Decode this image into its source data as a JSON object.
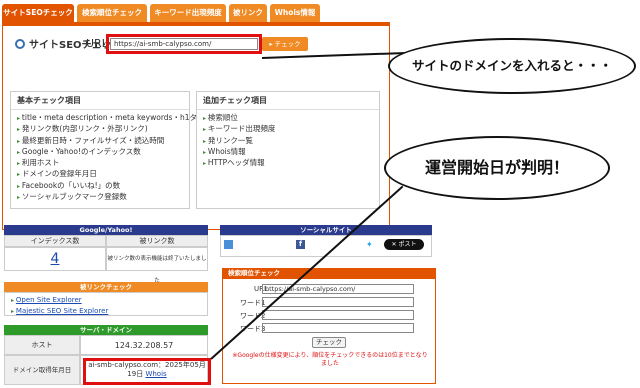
{
  "tabs": [
    {
      "label": "サイトSEOチェック",
      "active": true
    },
    {
      "label": "検索順位チェック",
      "active": false
    },
    {
      "label": "キーワード出現頻度",
      "active": false
    },
    {
      "label": "被リンク",
      "active": false
    },
    {
      "label": "Whois情報",
      "active": false
    }
  ],
  "seo": {
    "title": "サイトSEOチェック",
    "url_label": "URL",
    "url_value": "https://ai-smb-calypso.com/",
    "check_button": "チェック",
    "basic": {
      "title": "基本チェック項目",
      "items": [
        "title・meta description・meta keywords・h1タグ",
        "発リンク数(内部リンク・外部リンク)",
        "最終更新日時・ファイルサイズ・読込時間",
        "Google・Yahoo!のインデックス数",
        "利用ホスト",
        "ドメインの登録年月日",
        "Facebookの「いいね!」の数",
        "ソーシャルブックマーク登録数"
      ]
    },
    "extra": {
      "title": "追加チェック項目",
      "items": [
        "検索順位",
        "キーワード出現頻度",
        "発リンク一覧",
        "Whois情報",
        "HTTPヘッダ情報"
      ]
    }
  },
  "google_yahoo": {
    "header": "Google/Yahoo!",
    "index_label": "インデックス数",
    "backlink_label": "被リンク数",
    "index_value": "4",
    "backlink_note": "被リンク数の表示機能は終了いたしました"
  },
  "social": {
    "header": "ソーシャルサイト",
    "share_button": "ポスト"
  },
  "backlink_check": {
    "header": "被リンクチェック",
    "links": [
      "Open Site Explorer",
      "Majestic SEO Site Explorer"
    ]
  },
  "server": {
    "header": "サーバ・ドメイン",
    "host_label": "ホスト",
    "host_value": "124.32.208.57",
    "domain_label": "ドメイン取得年月日",
    "domain_value": "ai-smb-calypso.com：2025年05月19日",
    "whois_link": "Whois"
  },
  "rank_check": {
    "header": "検索順位チェック",
    "url_label": "URL",
    "url_value": "https://ai-smb-calypso.com/",
    "word_labels": [
      "ワード1",
      "ワード2",
      "ワード3"
    ],
    "check_button": "チェック",
    "note": "※Googleの仕様変更により、順位をチェックできるのは10位までとなりました"
  },
  "callouts": {
    "domain_hint": "サイトのドメインを入れると・・・",
    "start_date_hint": "運営開始日が判明！"
  },
  "colors": {
    "tab_orange": "#f08a24",
    "tab_active": "#e25300",
    "navy": "#2a3a8c",
    "green": "#2e9a2a",
    "red_highlight": "#e01010"
  }
}
